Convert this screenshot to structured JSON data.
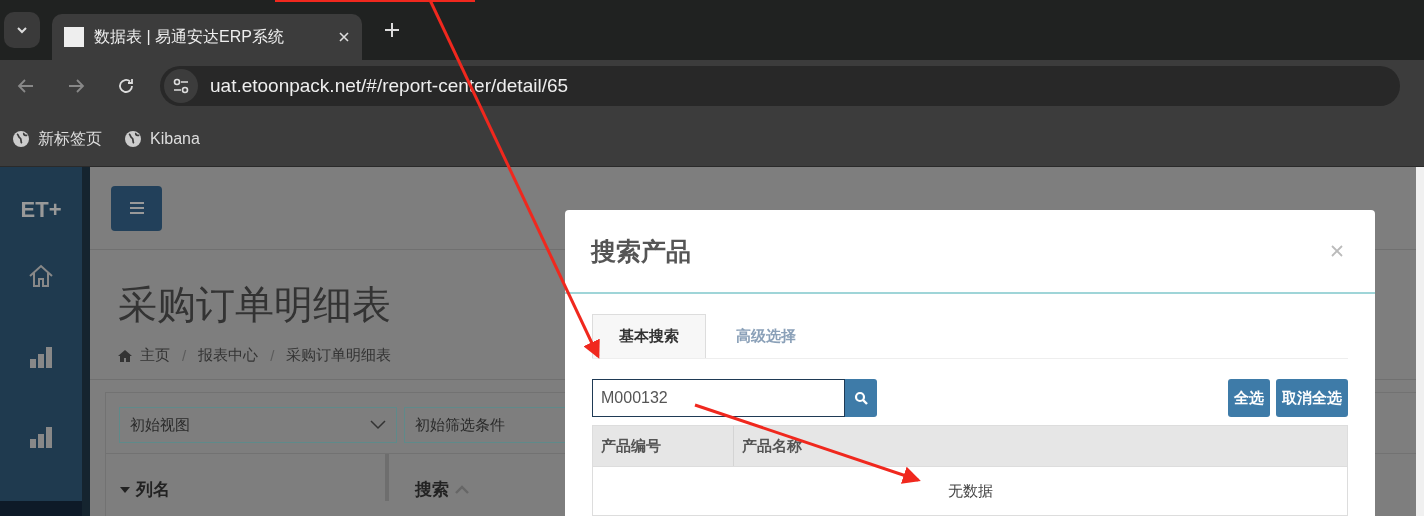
{
  "browser": {
    "tab_title": "数据表 | 易通安达ERP系统",
    "url": "uat.etoonpack.net/#/report-center/detail/65",
    "bookmarks": [
      "新标签页",
      "Kibana"
    ]
  },
  "sidebar": {
    "logo": "ET+"
  },
  "page": {
    "title": "采购订单明细表",
    "breadcrumb": [
      "主页",
      "报表中心",
      "采购订单明细表"
    ],
    "breadcrumb_separator": "/",
    "view_select": "初始视图",
    "filter_select": "初始筛选条件",
    "column_heading": "列名",
    "search_heading": "搜索"
  },
  "modal": {
    "title": "搜索产品",
    "tabs": [
      {
        "label": "基本搜索",
        "selected": true
      },
      {
        "label": "高级选择",
        "selected": false
      }
    ],
    "search_value": "M000132",
    "buttons": [
      "全选",
      "取消全选"
    ],
    "columns": [
      "产品编号",
      "产品名称"
    ],
    "empty_text": "无数据"
  }
}
